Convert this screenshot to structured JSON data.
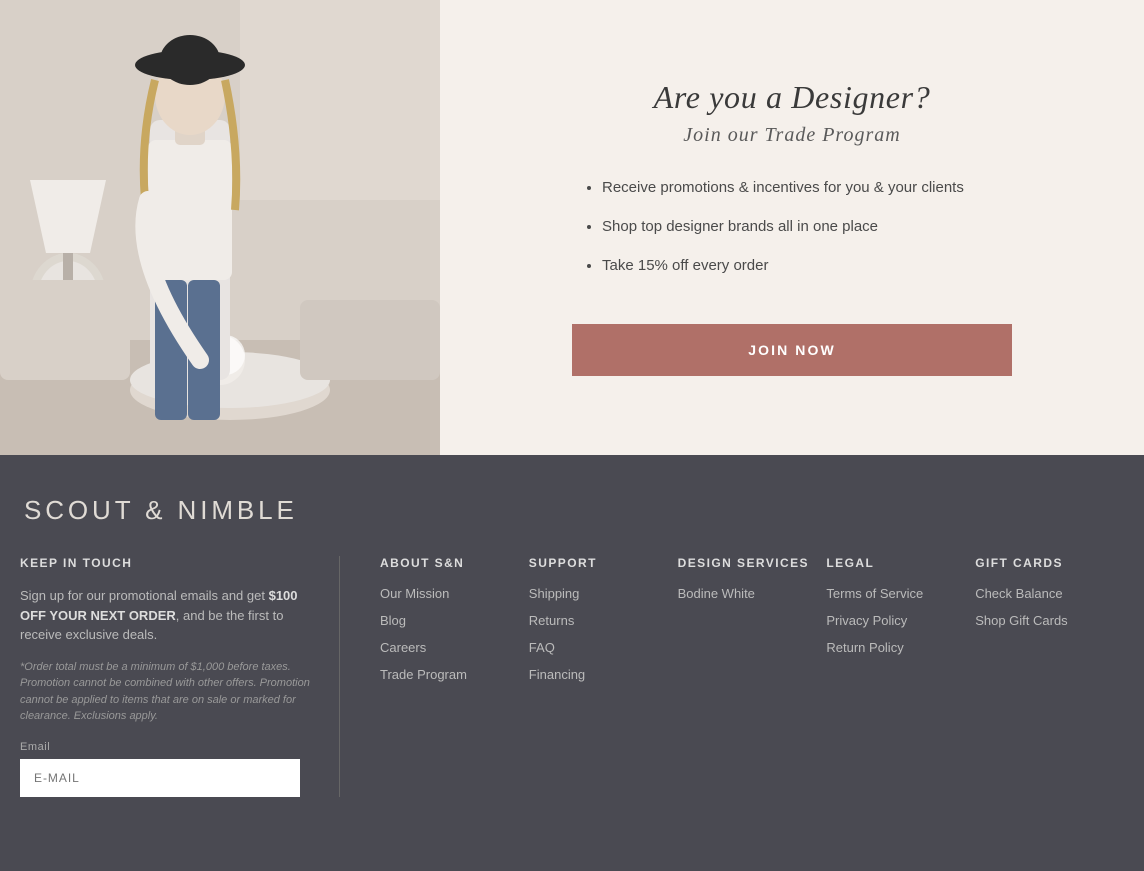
{
  "hero": {
    "title": "Are you a Designer?",
    "subtitle": "Join our Trade Program",
    "bullets": [
      "Receive promotions & incentives for you & your clients",
      "Shop top designer brands all in one place",
      "Take 15% off every order"
    ],
    "join_button_label": "JOIN NOW"
  },
  "footer": {
    "brand": "SCOUT & NIMBLE",
    "keep_in_touch": {
      "section_label": "KEEP IN TOUCH",
      "body_text": "Sign up for our promotional emails and get ",
      "highlight": "$100 OFF YOUR NEXT ORDER",
      "body_suffix": ", and be the first to receive exclusive deals.",
      "note": "*Order total must be a minimum of $1,000 before taxes. Promotion cannot be combined with other offers. Promotion cannot be applied to items that are on sale or marked for clearance. Exclusions apply.",
      "email_label": "Email",
      "email_placeholder": "E-MAIL"
    },
    "columns": [
      {
        "title": "ABOUT S&N",
        "links": [
          "Our Mission",
          "Blog",
          "Careers",
          "Trade Program"
        ]
      },
      {
        "title": "SUPPORT",
        "links": [
          "Shipping",
          "Returns",
          "FAQ",
          "Financing"
        ]
      },
      {
        "title": "DESIGN SERVICES",
        "links": [
          "Bodine White"
        ]
      },
      {
        "title": "LEGAL",
        "links": [
          "Terms of Service",
          "Privacy Policy",
          "Return Policy"
        ]
      },
      {
        "title": "GIFT CARDS",
        "links": [
          "Check Balance",
          "Shop Gift Cards"
        ]
      }
    ]
  }
}
